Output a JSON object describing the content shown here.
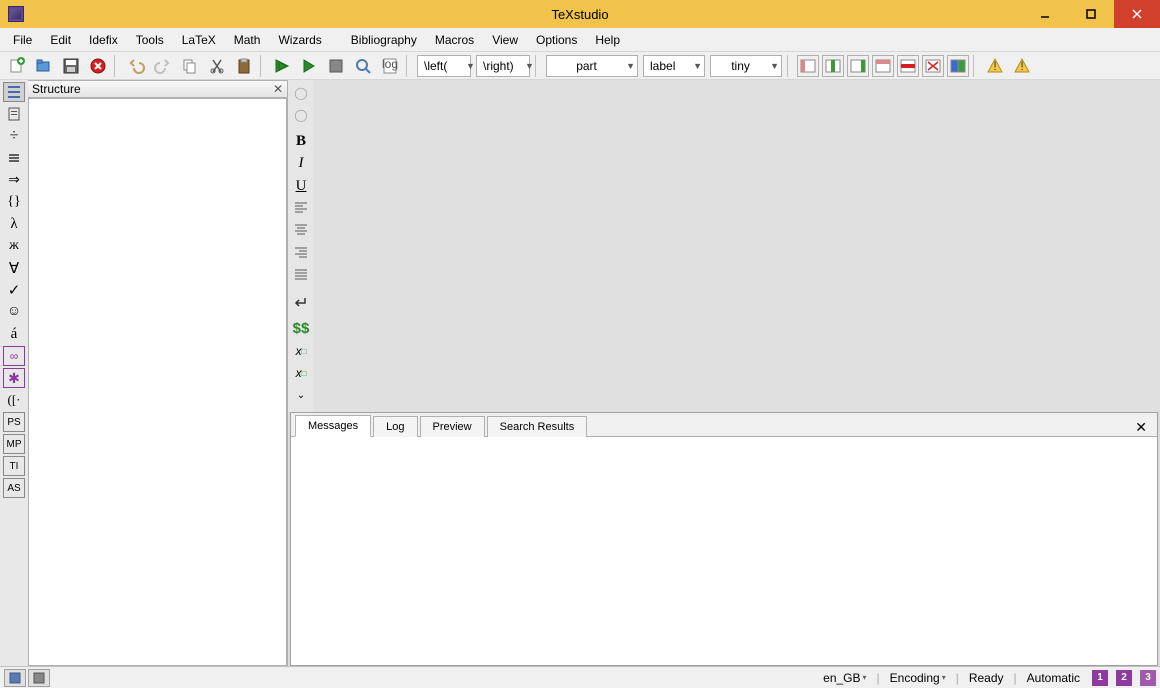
{
  "titlebar": {
    "title": "TeXstudio"
  },
  "menubar": {
    "items": [
      "File",
      "Edit",
      "Idefix",
      "Tools",
      "LaTeX",
      "Math",
      "Wizards",
      "Bibliography",
      "Macros",
      "View",
      "Options",
      "Help"
    ]
  },
  "toolbar": {
    "dropdowns": {
      "left": "\\left(",
      "right": "\\right)",
      "part": "part",
      "label": "label",
      "tiny": "tiny"
    }
  },
  "structure": {
    "title": "Structure"
  },
  "messages": {
    "tabs": [
      "Messages",
      "Log",
      "Preview",
      "Search Results"
    ]
  },
  "statusbar": {
    "lang": "en_GB",
    "encoding": "Encoding",
    "ready": "Ready",
    "automatic": "Automatic",
    "badges": [
      "1",
      "2",
      "3"
    ]
  }
}
